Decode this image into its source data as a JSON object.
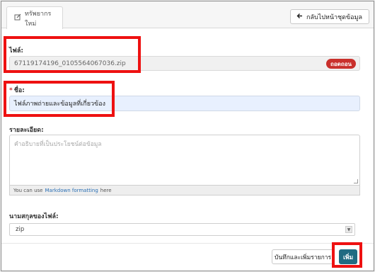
{
  "tab": {
    "icon": "edit-icon",
    "label": "ทรัพยากรใหม่"
  },
  "header": {
    "back_icon": "arrow-left-icon",
    "back_label": "กลับไปหน้าชุดข้อมูล"
  },
  "form": {
    "file_label": "ไฟล์:",
    "file_value": "67119174196_0105564067036.zip",
    "remove_label": "ถอดถอน",
    "name_required_mark": "*",
    "name_label": "ชื่อ:",
    "name_value": "ไฟล์ภาพถ่ายและข้อมูลที่เกี่ยวข้อง",
    "description_label": "รายละเอียด:",
    "description_placeholder": "คำอธิบายที่เป็นประโยชน์ต่อข้อมูล",
    "markdown_help_prefix": "You can use",
    "markdown_help_link": "Markdown formatting",
    "markdown_help_suffix": "here",
    "format_label": "นามสกุลของไฟล์:",
    "format_value": "zip"
  },
  "footer": {
    "save_and_add_label": "บันทึกและเพิ่มรายการ",
    "add_label": "เพิ่ม"
  },
  "colors": {
    "highlight": "#e11111",
    "primary_button": "#206b82",
    "danger_button": "#c9302c",
    "autofill_bg": "#e8f0fe"
  }
}
